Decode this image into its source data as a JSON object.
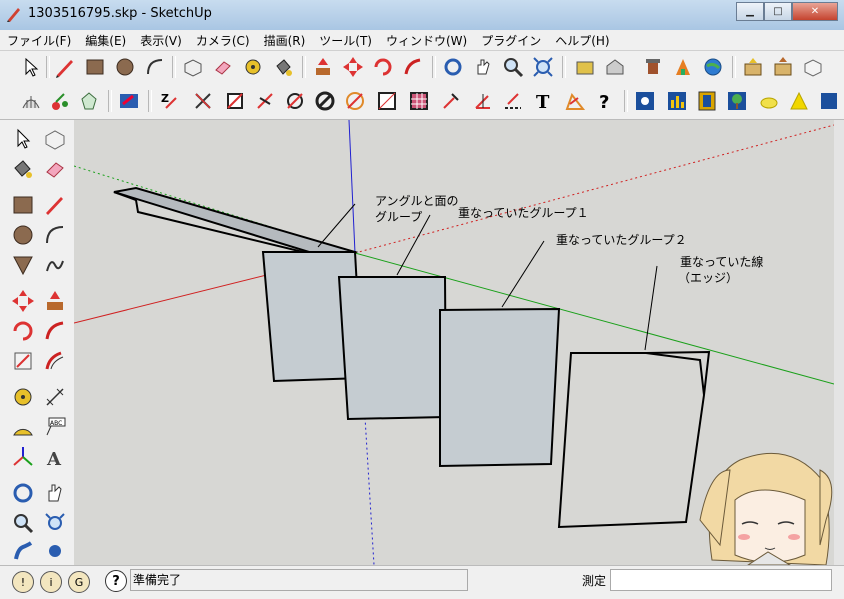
{
  "window": {
    "title": "1303516795.skp - SketchUp"
  },
  "menu": [
    "ファイル(F)",
    "編集(E)",
    "表示(V)",
    "カメラ(C)",
    "描画(R)",
    "ツール(T)",
    "ウィンドウ(W)",
    "プラグイン",
    "ヘルプ(H)"
  ],
  "toolbar1": [
    "select-tool-icon",
    "pencil-line-icon",
    "rectangle-icon",
    "circle-icon",
    "arc-icon",
    "make-component-icon",
    "eraser-icon",
    "tape-measure-icon",
    "paint-bucket-icon",
    "push-pull-icon",
    "move-icon",
    "rotate-icon",
    "follow-me-icon",
    "orbit-icon",
    "pan-icon",
    "zoom-icon",
    "zoom-extents-icon",
    "get-models-icon",
    "share-model-icon",
    "3d-warehouse-icon",
    "photo-textures-icon",
    "google-earth-icon",
    "get-component-icon",
    "share-component-icon",
    "preview-icon"
  ],
  "toolbar2": [
    "sandbox-icon",
    "apple-icon",
    "gem-icon",
    "flip-icon",
    "zorro-icon",
    "cut-icon",
    "square-icon",
    "knife-icon",
    "slash-circle-icon",
    "no-circle-icon",
    "slash-orange-icon",
    "grid-square-icon",
    "hatch-square-icon",
    "dimension-icon",
    "angle-dim-icon",
    "dashed-line-icon",
    "text-tool-icon",
    "angle-icon",
    "help-question-icon",
    "layer-blue-icon",
    "chart-blue-icon",
    "film-icon",
    "tree-icon",
    "lemon-icon",
    "cone-icon",
    "cube-blue-icon"
  ],
  "annotations": {
    "a1_line1": "アングルと面の",
    "a1_line2": "グループ",
    "a2": "重なっていたグループ１",
    "a3": "重なっていたグループ２",
    "a4_line1": "重なっていた線",
    "a4_line2": "（エッジ）"
  },
  "status": {
    "text": "準備完了",
    "measure_label": "測定",
    "measure_value": ""
  },
  "colors": {
    "axis_red": "#d02020",
    "axis_green": "#1aa01a",
    "axis_blue": "#2020d0",
    "face": "#c5ccd1",
    "background": "#d7d7d4"
  }
}
